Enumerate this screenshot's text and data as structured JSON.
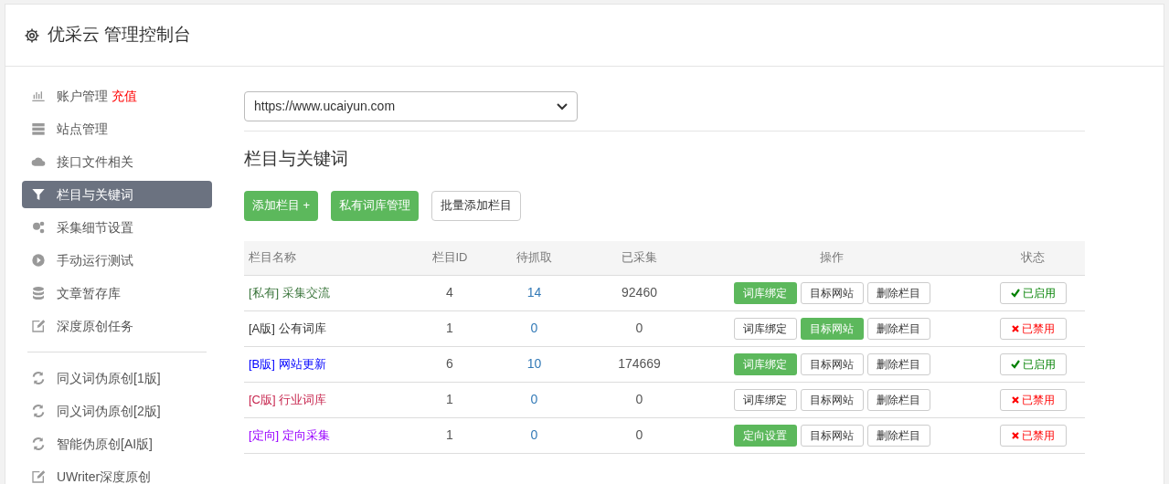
{
  "header": {
    "title": "优采云 管理控制台"
  },
  "sidebar": {
    "items": [
      {
        "label": "账户管理",
        "badge": "充值",
        "selected": false
      },
      {
        "label": "站点管理",
        "selected": false
      },
      {
        "label": "接口文件相关",
        "selected": false
      },
      {
        "label": "栏目与关键词",
        "selected": true
      },
      {
        "label": "采集细节设置",
        "selected": false
      },
      {
        "label": "手动运行测试",
        "selected": false
      },
      {
        "label": "文章暂存库",
        "selected": false
      },
      {
        "label": "深度原创任务",
        "selected": false
      },
      {
        "kind": "divider"
      },
      {
        "label": "同义词伪原创[1版]",
        "selected": false
      },
      {
        "label": "同义词伪原创[2版]",
        "selected": false
      },
      {
        "label": "智能伪原创[AI版]",
        "selected": false
      },
      {
        "label": "UWriter深度原创",
        "selected": false
      }
    ]
  },
  "site_select": {
    "value": "https://www.ucaiyun.com"
  },
  "section_title": "栏目与关键词",
  "toolbar": [
    {
      "label": "添加栏目 +",
      "primary": true
    },
    {
      "label": "私有词库管理",
      "primary": true
    },
    {
      "label": "批量添加栏目",
      "primary": false
    }
  ],
  "table": {
    "columns": [
      "栏目名称",
      "栏目ID",
      "待抓取",
      "已采集",
      "操作",
      "状态"
    ],
    "rows": [
      {
        "tag": "[私有]",
        "name": "采集交流",
        "color": "#3c763d",
        "id": "4",
        "pending": "14",
        "collected": "92460",
        "actions": [
          {
            "label": "词库绑定",
            "active": true
          },
          {
            "label": "目标网站",
            "active": false
          },
          {
            "label": "删除栏目",
            "active": false
          }
        ],
        "status": "已启用",
        "enabled": true
      },
      {
        "tag": "[A版]",
        "name": "公有词库",
        "color": "#333333",
        "id": "1",
        "pending": "0",
        "collected": "0",
        "actions": [
          {
            "label": "词库绑定",
            "active": false
          },
          {
            "label": "目标网站",
            "active": true
          },
          {
            "label": "删除栏目",
            "active": false
          }
        ],
        "status": "已禁用",
        "enabled": false
      },
      {
        "tag": "[B版]",
        "name": "网站更新",
        "color": "#0000ff",
        "id": "6",
        "pending": "10",
        "collected": "174669",
        "actions": [
          {
            "label": "词库绑定",
            "active": true
          },
          {
            "label": "目标网站",
            "active": false
          },
          {
            "label": "删除栏目",
            "active": false
          }
        ],
        "status": "已启用",
        "enabled": true
      },
      {
        "tag": "[C版]",
        "name": "行业词库",
        "color": "#c7254e",
        "id": "1",
        "pending": "0",
        "collected": "0",
        "actions": [
          {
            "label": "词库绑定",
            "active": false
          },
          {
            "label": "目标网站",
            "active": false
          },
          {
            "label": "删除栏目",
            "active": false
          }
        ],
        "status": "已禁用",
        "enabled": false
      },
      {
        "tag": "[定向]",
        "name": "定向采集",
        "color": "#9900ff",
        "id": "1",
        "pending": "0",
        "collected": "0",
        "actions": [
          {
            "label": "定向设置",
            "active": true
          },
          {
            "label": "目标网站",
            "active": false
          },
          {
            "label": "删除栏目",
            "active": false
          }
        ],
        "status": "已禁用",
        "enabled": false
      }
    ]
  }
}
